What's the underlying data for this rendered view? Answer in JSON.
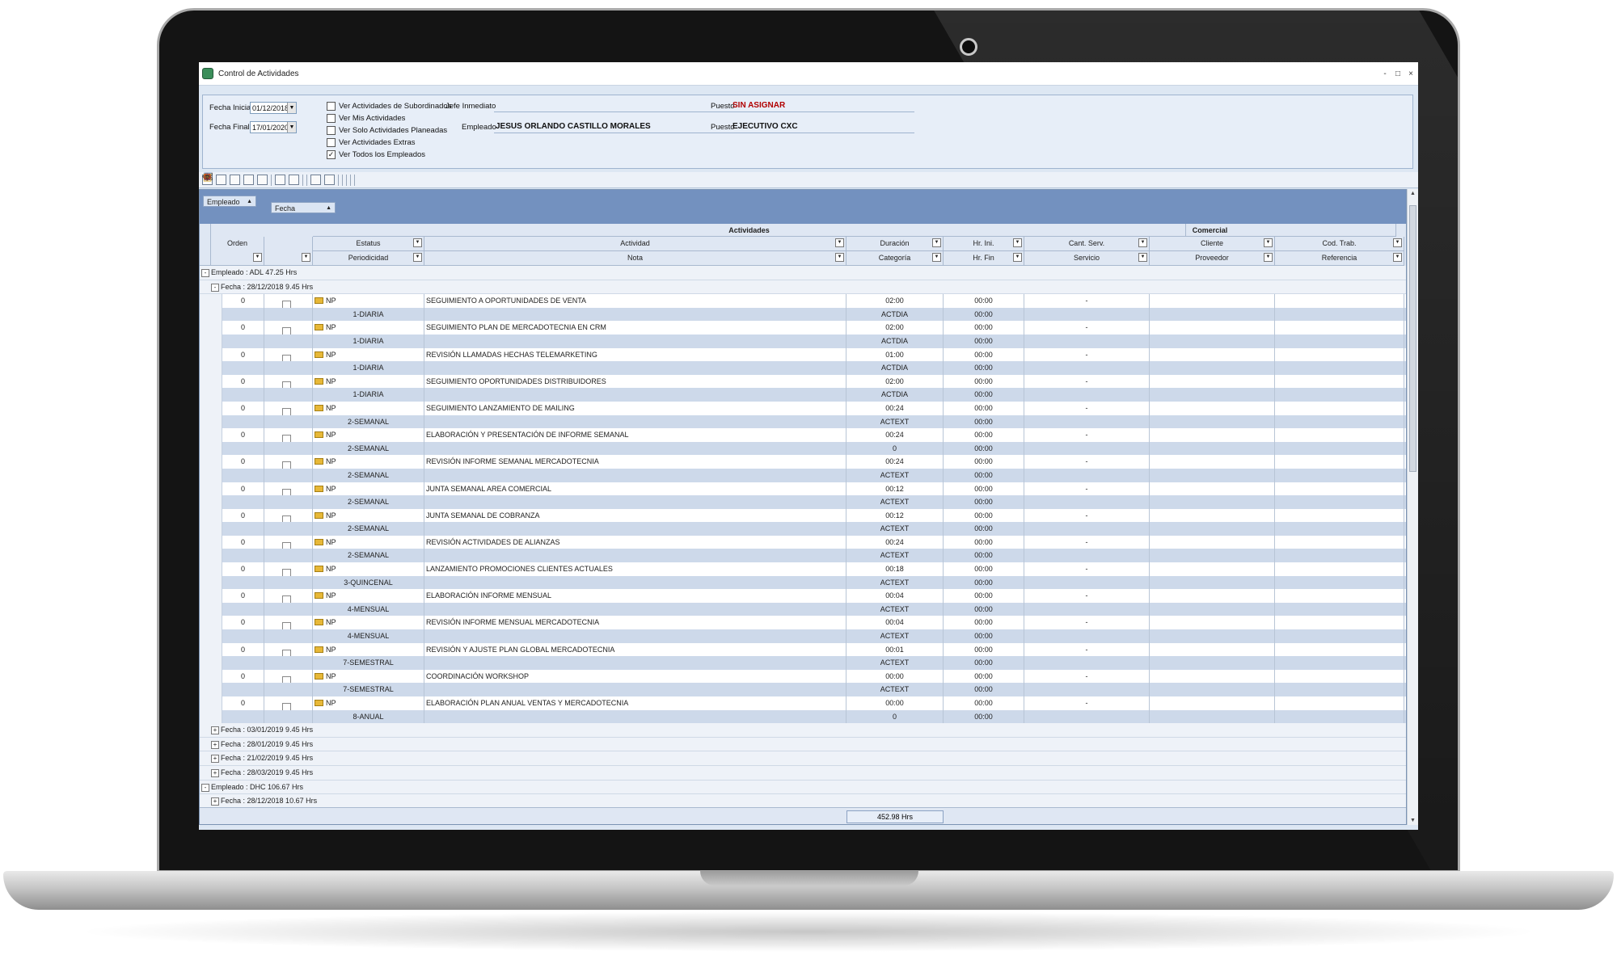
{
  "window": {
    "title": "Control de Actividades",
    "controls": [
      "-",
      "□",
      "×"
    ]
  },
  "filters": {
    "fecha_inicial_label": "Fecha Inicial",
    "fecha_inicial": "01/12/2018",
    "fecha_final_label": "Fecha Final",
    "fecha_final": "17/01/2020",
    "checks": [
      {
        "label": "Ver Actividades de Subordinados",
        "checked": false
      },
      {
        "label": "Ver Mis Actividades",
        "checked": false
      },
      {
        "label": "Ver Solo Actividades Planeadas",
        "checked": false
      },
      {
        "label": "Ver Actividades Extras",
        "checked": false
      },
      {
        "label": "Ver Todos los Empleados",
        "checked": true
      }
    ],
    "jefe_label": "Jefe Inmediato",
    "jefe_value": "",
    "empleado_label": "Empleado",
    "empleado_value": "JESUS ORLANDO CASTILLO MORALES",
    "puesto1_label": "Puesto",
    "puesto1_value": "SIN ASIGNAR",
    "puesto2_label": "Puesto",
    "puesto2_value": "EJECUTIVO CXC",
    "accent_red": "#b10000"
  },
  "groupbar": {
    "chips": [
      "Empleado",
      "Fecha"
    ]
  },
  "header": {
    "band_actividades": "Actividades",
    "band_comercial": "Comercial",
    "orden": "Orden",
    "estatus": "Estatus",
    "periodicidad": "Periodicidad",
    "actividad": "Actividad",
    "nota": "Nota",
    "duracion": "Duración",
    "categoria": "Categoría",
    "hr_ini": "Hr. Ini.",
    "hr_fin": "Hr. Fin",
    "cant_serv": "Cant. Serv.",
    "servicio": "Servicio",
    "cliente": "Cliente",
    "proveedor": "Proveedor",
    "cod_trab": "Cod. Trab.",
    "referencia": "Referencia"
  },
  "groups": {
    "emp1": "Empleado : ADL 47.25 Hrs",
    "fecha1": "Fecha : 28/12/2018 9.45 Hrs",
    "collapsed_dates": [
      "Fecha : 03/01/2019 9.45 Hrs",
      "Fecha : 28/01/2019 9.45 Hrs",
      "Fecha : 21/02/2019 9.45 Hrs",
      "Fecha : 28/03/2019 9.45 Hrs"
    ],
    "emp2": "Empleado : DHC 106.67 Hrs",
    "fecha2": "Fecha : 28/12/2018 10.67 Hrs"
  },
  "activities": [
    {
      "orden": "0",
      "estatus": "NP",
      "periodicidad": "1-DIARIA",
      "actividad": "SEGUIMIENTO A OPORTUNIDADES DE VENTA",
      "duracion": "02:00",
      "categoria": "ACTDIA",
      "hr_ini": "00:00",
      "hr_fin": "00:00",
      "cant": "-"
    },
    {
      "orden": "0",
      "estatus": "NP",
      "periodicidad": "1-DIARIA",
      "actividad": "SEGUIMIENTO PLAN DE MERCADOTECNIA EN CRM",
      "duracion": "02:00",
      "categoria": "ACTDIA",
      "hr_ini": "00:00",
      "hr_fin": "00:00",
      "cant": "-"
    },
    {
      "orden": "0",
      "estatus": "NP",
      "periodicidad": "1-DIARIA",
      "actividad": "REVISIÓN LLAMADAS HECHAS TELEMARKETING",
      "duracion": "01:00",
      "categoria": "ACTDIA",
      "hr_ini": "00:00",
      "hr_fin": "00:00",
      "cant": "-"
    },
    {
      "orden": "0",
      "estatus": "NP",
      "periodicidad": "1-DIARIA",
      "actividad": "SEGUIMIENTO OPORTUNIDADES DISTRIBUIDORES",
      "duracion": "02:00",
      "categoria": "ACTDIA",
      "hr_ini": "00:00",
      "hr_fin": "00:00",
      "cant": "-"
    },
    {
      "orden": "0",
      "estatus": "NP",
      "periodicidad": "2-SEMANAL",
      "actividad": "SEGUIMIENTO LANZAMIENTO DE MAILING",
      "duracion": "00:24",
      "categoria": "ACTEXT",
      "hr_ini": "00:00",
      "hr_fin": "00:00",
      "cant": "-"
    },
    {
      "orden": "0",
      "estatus": "NP",
      "periodicidad": "2-SEMANAL",
      "actividad": "ELABORACIÓN Y PRESENTACIÓN DE INFORME SEMANAL",
      "duracion": "00:24",
      "categoria": "0",
      "hr_ini": "00:00",
      "hr_fin": "00:00",
      "cant": "-"
    },
    {
      "orden": "0",
      "estatus": "NP",
      "periodicidad": "2-SEMANAL",
      "actividad": "REVISIÓN INFORME SEMANAL MERCADOTECNIA",
      "duracion": "00:24",
      "categoria": "ACTEXT",
      "hr_ini": "00:00",
      "hr_fin": "00:00",
      "cant": "-"
    },
    {
      "orden": "0",
      "estatus": "NP",
      "periodicidad": "2-SEMANAL",
      "actividad": "JUNTA SEMANAL AREA COMERCIAL",
      "duracion": "00:12",
      "categoria": "ACTEXT",
      "hr_ini": "00:00",
      "hr_fin": "00:00",
      "cant": "-"
    },
    {
      "orden": "0",
      "estatus": "NP",
      "periodicidad": "2-SEMANAL",
      "actividad": "JUNTA SEMANAL DE COBRANZA",
      "duracion": "00:12",
      "categoria": "ACTEXT",
      "hr_ini": "00:00",
      "hr_fin": "00:00",
      "cant": "-"
    },
    {
      "orden": "0",
      "estatus": "NP",
      "periodicidad": "2-SEMANAL",
      "actividad": "REVISIÓN ACTIVIDADES DE ALIANZAS",
      "duracion": "00:24",
      "categoria": "ACTEXT",
      "hr_ini": "00:00",
      "hr_fin": "00:00",
      "cant": "-"
    },
    {
      "orden": "0",
      "estatus": "NP",
      "periodicidad": "3-QUINCENAL",
      "actividad": "LANZAMIENTO PROMOCIONES CLIENTES ACTUALES",
      "duracion": "00:18",
      "categoria": "ACTEXT",
      "hr_ini": "00:00",
      "hr_fin": "00:00",
      "cant": "-"
    },
    {
      "orden": "0",
      "estatus": "NP",
      "periodicidad": "4-MENSUAL",
      "actividad": "ELABORACIÓN INFORME MENSUAL",
      "duracion": "00:04",
      "categoria": "ACTEXT",
      "hr_ini": "00:00",
      "hr_fin": "00:00",
      "cant": "-"
    },
    {
      "orden": "0",
      "estatus": "NP",
      "periodicidad": "4-MENSUAL",
      "actividad": "REVISIÓN INFORME MENSUAL MERCADOTECNIA",
      "duracion": "00:04",
      "categoria": "ACTEXT",
      "hr_ini": "00:00",
      "hr_fin": "00:00",
      "cant": "-"
    },
    {
      "orden": "0",
      "estatus": "NP",
      "periodicidad": "7-SEMESTRAL",
      "actividad": "REVISIÓN Y AJUSTE PLAN GLOBAL MERCADOTECNIA",
      "duracion": "00:01",
      "categoria": "ACTEXT",
      "hr_ini": "00:00",
      "hr_fin": "00:00",
      "cant": "-"
    },
    {
      "orden": "0",
      "estatus": "NP",
      "periodicidad": "7-SEMESTRAL",
      "actividad": "COORDINACIÓN WORKSHOP",
      "duracion": "00:00",
      "categoria": "ACTEXT",
      "hr_ini": "00:00",
      "hr_fin": "00:00",
      "cant": "-"
    },
    {
      "orden": "0",
      "estatus": "NP",
      "periodicidad": "8-ANUAL",
      "actividad": "ELABORACIÓN PLAN ANUAL VENTAS Y MERCADOTECNIA",
      "duracion": "00:00",
      "categoria": "0",
      "hr_ini": "00:00",
      "hr_fin": "00:00",
      "cant": "-"
    }
  ],
  "footer": {
    "total": "452.98 Hrs"
  }
}
